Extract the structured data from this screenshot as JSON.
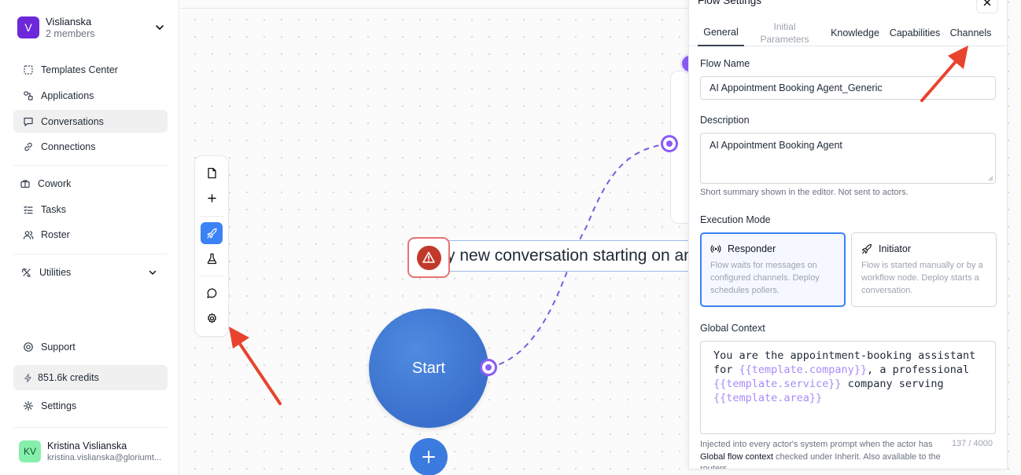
{
  "workspace": {
    "initial": "V",
    "name": "Vislianska",
    "members": "2 members"
  },
  "nav": {
    "templates": "Templates Center",
    "applications": "Applications",
    "conversations": "Conversations",
    "connections": "Connections",
    "cowork": "Cowork",
    "tasks": "Tasks",
    "roster": "Roster",
    "utilities": "Utilities",
    "support": "Support",
    "credits": "851.6k credits",
    "settings": "Settings"
  },
  "user": {
    "initials": "KV",
    "name": "Kristina Vislianska",
    "email": "kristina.vislianska@gloriumt..."
  },
  "canvas": {
    "trigger_text": "y new conversation starting on an",
    "start_label": "Start"
  },
  "panel": {
    "title": "Flow Settings",
    "tabs": {
      "general": "General",
      "initial_1": "Initial",
      "initial_2": "Parameters",
      "knowledge": "Knowledge",
      "capabilities": "Capabilities",
      "channels": "Channels"
    },
    "flow_name_label": "Flow Name",
    "flow_name_value": "AI Appointment Booking Agent_Generic",
    "description_label": "Description",
    "description_value": "AI Appointment Booking Agent",
    "description_hint": "Short summary shown in the editor. Not sent to actors.",
    "execution_mode_label": "Execution Mode",
    "responder": {
      "title": "Responder",
      "desc": "Flow waits for messages on configured channels. Deploy schedules pollers."
    },
    "initiator": {
      "title": "Initiator",
      "desc": "Flow is started manually or by a workflow node. Deploy starts a conversation."
    },
    "global_context_label": "Global Context",
    "context": {
      "p1": "You are the appointment-booking assistant\nfor ",
      "v1": "{{template.company}}",
      "p2": ", a professional\n",
      "v2": "{{template.service}}",
      "p3": " company serving\n",
      "v3": "{{template.area}}"
    },
    "counter": "137 / 4000",
    "inject": {
      "pre": "Injected into every actor's system prompt when the actor has ",
      "bold": "Global flow context",
      "post": " checked under Inherit. Also available to the routers."
    }
  },
  "colors": {
    "accent": "#3b82f6",
    "port": "#8b5cf6",
    "annotation": "#e8432e",
    "start": "#3a70cc"
  }
}
